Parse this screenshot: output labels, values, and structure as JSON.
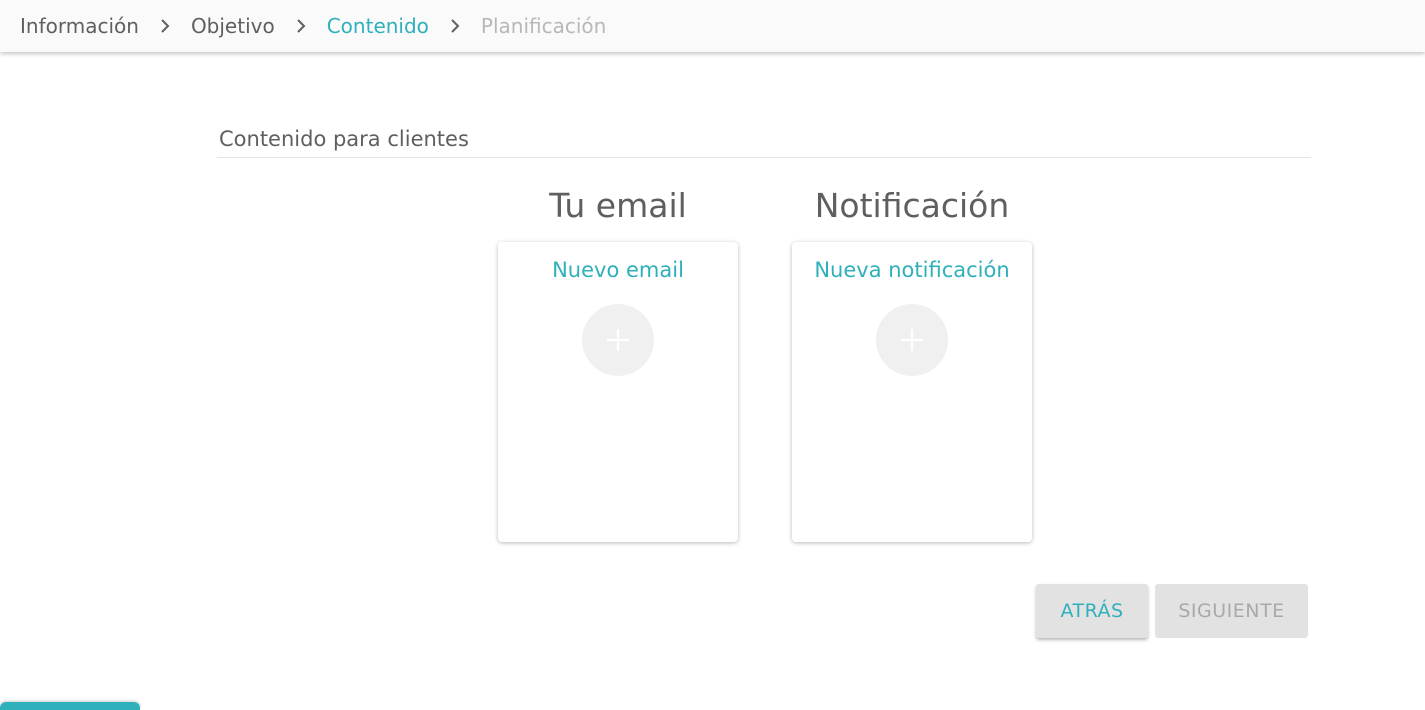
{
  "stepper": {
    "steps": [
      {
        "label": "Información",
        "state": "completed"
      },
      {
        "label": "Objetivo",
        "state": "completed"
      },
      {
        "label": "Contenido",
        "state": "active"
      },
      {
        "label": "Planificación",
        "state": "disabled"
      }
    ],
    "separator_icon": "chevron-right-icon"
  },
  "section": {
    "title": "Contenido para clientes"
  },
  "columns": [
    {
      "heading": "Tu email",
      "card_label": "Nuevo email",
      "add_icon": "plus-icon"
    },
    {
      "heading": "Notificación",
      "card_label": "Nueva notificación",
      "add_icon": "plus-icon"
    }
  ],
  "actions": {
    "back_label": "ATRÁS",
    "next_label": "SIGUIENTE",
    "next_enabled": false
  },
  "colors": {
    "accent": "#2fb0ba",
    "text": "#5f5f5f",
    "disabled_text": "#b8b8b8",
    "button_bg": "#e2e2e2"
  }
}
